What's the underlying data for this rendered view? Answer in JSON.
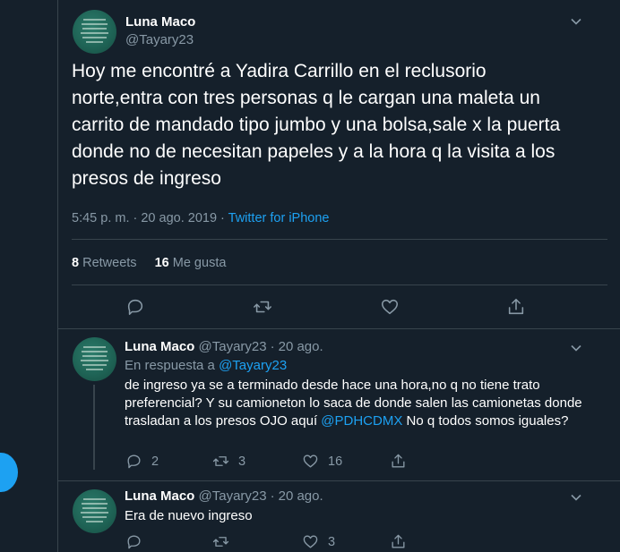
{
  "main_tweet": {
    "author_name": "Luna Maco",
    "author_handle": "@Tayary23",
    "text": "Hoy me encontré a Yadira Carrillo en el reclusorio norte,entra con tres personas q le cargan una maleta un carrito de mandado tipo jumbo y una bolsa,sale x la puerta donde no de necesitan papeles y a la hora q la visita a los presos de ingreso",
    "timestamp": "5:45 p. m. · 20 ago. 2019",
    "separator": " · ",
    "source": "Twitter for iPhone",
    "retweets_count": "8",
    "retweets_label": "Retweets",
    "likes_count": "16",
    "likes_label": "Me gusta"
  },
  "replies": [
    {
      "author_name": "Luna Maco",
      "author_handle": "@Tayary23",
      "date": "20 ago.",
      "replying_prefix": "En respuesta a",
      "replying_to": "@Tayary23",
      "text_before": "de ingreso ya se a terminado desde hace una hora,no q no tiene trato preferencial? Y su camioneton  lo saca de donde salen las camionetas donde trasladan a los presos OJO  aquí ",
      "mention": "@PDHCDMX",
      "text_after": "  No q todos somos iguales?",
      "reply_count": "2",
      "retweet_count": "3",
      "like_count": "16"
    },
    {
      "author_name": "Luna Maco",
      "author_handle": "@Tayary23",
      "date": "20 ago.",
      "text": "Era de nuevo ingreso",
      "reply_count": "",
      "retweet_count": "",
      "like_count": "3"
    }
  ],
  "colors": {
    "background": "#15202b",
    "border": "#38444d",
    "secondary_text": "#8899a6",
    "accent": "#1da1f2"
  },
  "icons": [
    "chevron-down-icon",
    "reply-icon",
    "retweet-icon",
    "like-icon",
    "share-icon"
  ]
}
